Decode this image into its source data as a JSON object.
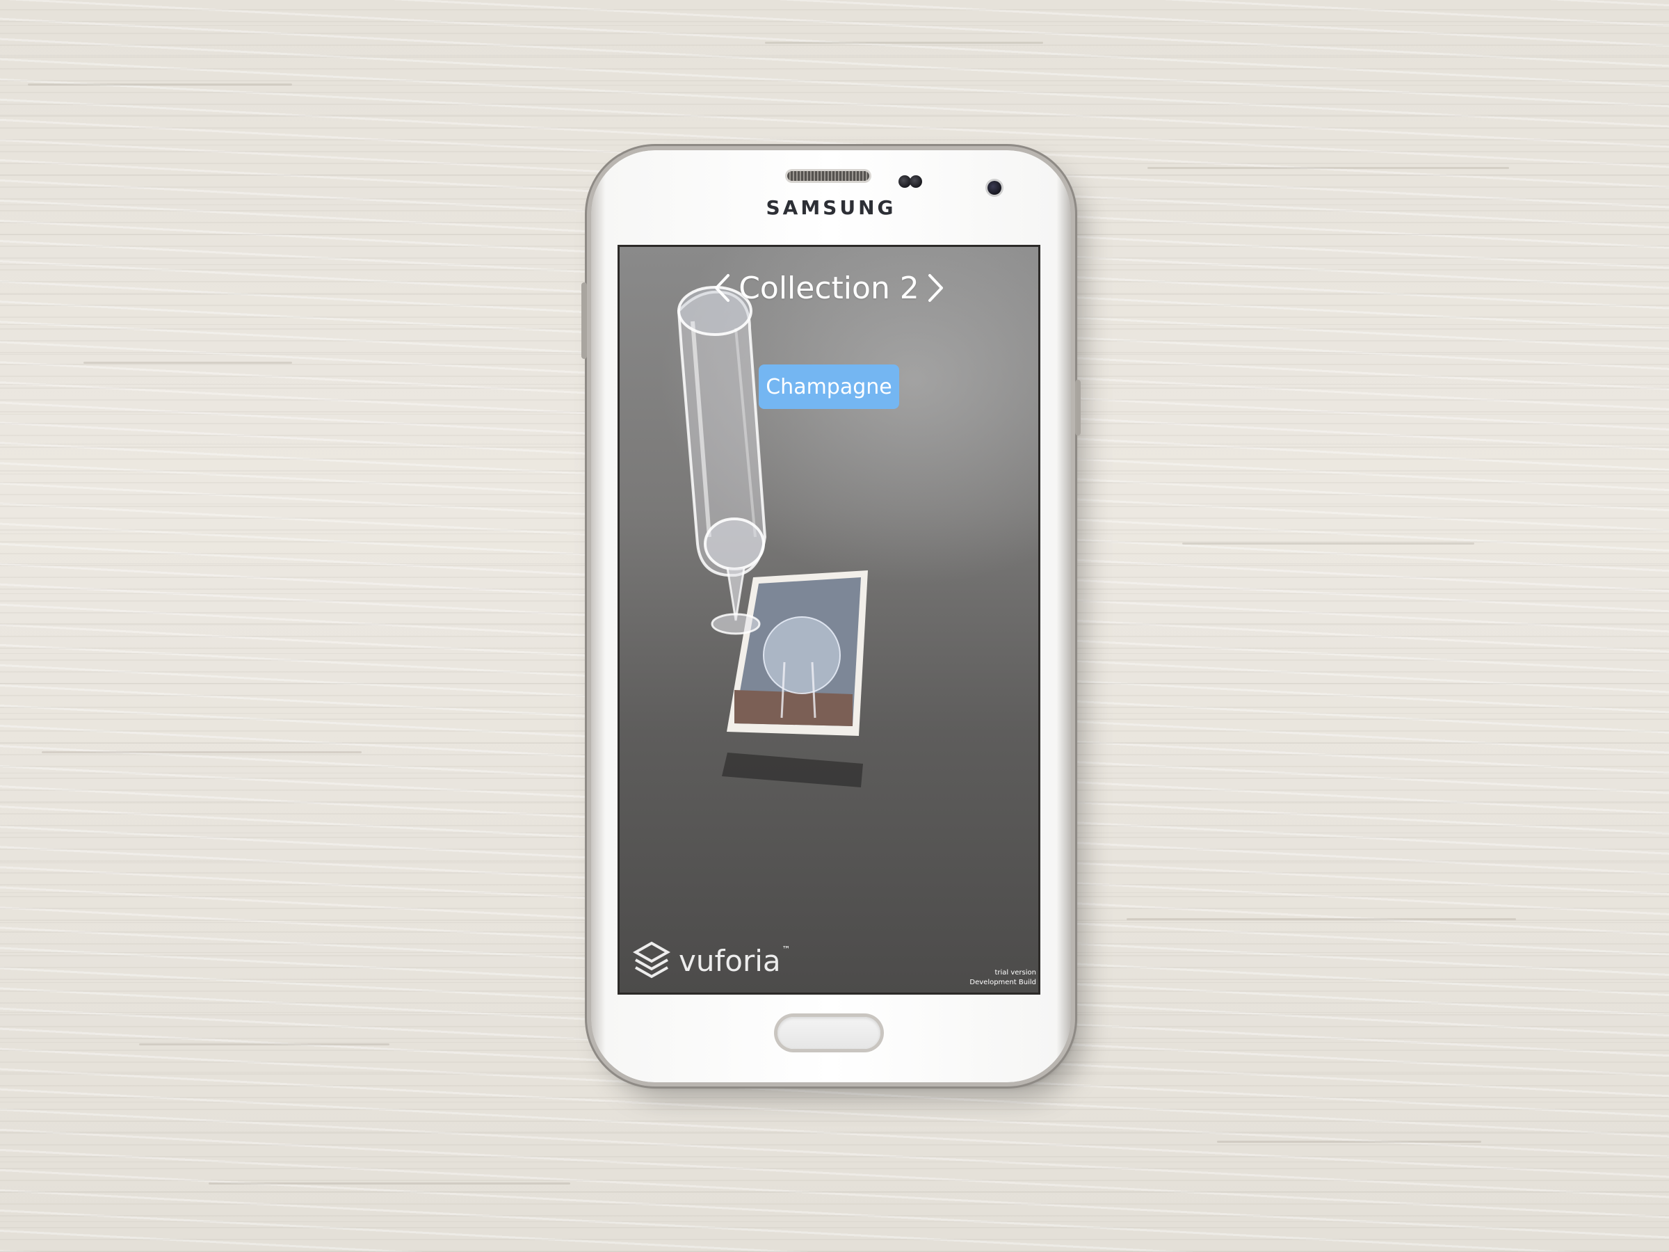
{
  "device": {
    "brand": "SAMSUNG",
    "body_color": "#f7f7f6",
    "trim_color": "#b9b5b0"
  },
  "app": {
    "collection_title": "Collection 2",
    "prev_icon": "chevron-left-icon",
    "next_icon": "chevron-right-icon",
    "selected_item": "Champagne",
    "selected_item_color": "#74b6f2",
    "ar_object": "champagne-glass",
    "target_image": "wine-glasses-photo"
  },
  "sdk": {
    "logo_icon": "vuforia-logo-icon",
    "logo_text": "vuforia",
    "trademark": "™",
    "trial_label": "trial version",
    "build_label": "Development Build"
  }
}
